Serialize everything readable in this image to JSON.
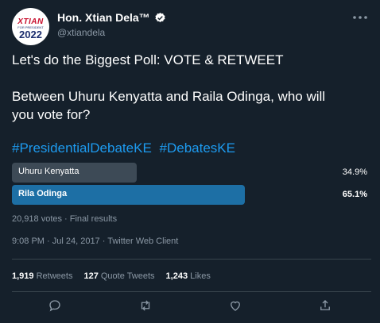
{
  "author": {
    "display_name": "Hon. Xtian Dela™",
    "handle": "@xtiandela",
    "avatar_text": "XTIAN",
    "avatar_sub": "FOR PRESIDENT",
    "avatar_year": "2022"
  },
  "tweet": {
    "line1": "Let's do the Biggest Poll: VOTE & RETWEET",
    "line2": "Between Uhuru Kenyatta and Raila Odinga, who will",
    "line3": "you vote for?",
    "hashtags": [
      "#PresidentialDebateKE",
      "#DebatesKE"
    ]
  },
  "poll": {
    "options": [
      {
        "label": "Uhuru Kenyatta",
        "percent_text": "34.9%",
        "share": 0.349,
        "winner": false
      },
      {
        "label": "Rila Odinga",
        "percent_text": "65.1%",
        "share": 0.651,
        "winner": true
      }
    ],
    "meta": "20,918 votes · Final results"
  },
  "timestamp": "9:08 PM · Jul 24, 2017 · Twitter Web Client",
  "stats": {
    "retweets_count": "1,919",
    "retweets_label": "Retweets",
    "quotes_count": "127",
    "quotes_label": "Quote Tweets",
    "likes_count": "1,243",
    "likes_label": "Likes"
  },
  "colors": {
    "background": "#15202b",
    "accent": "#1d9bf0",
    "winner_bar": "#1d6fa5",
    "loser_bar": "#3d4a56",
    "muted_text": "#8b98a5"
  },
  "icons": [
    "verified-badge-icon",
    "more-icon",
    "reply-icon",
    "retweet-icon",
    "like-icon",
    "share-icon"
  ]
}
